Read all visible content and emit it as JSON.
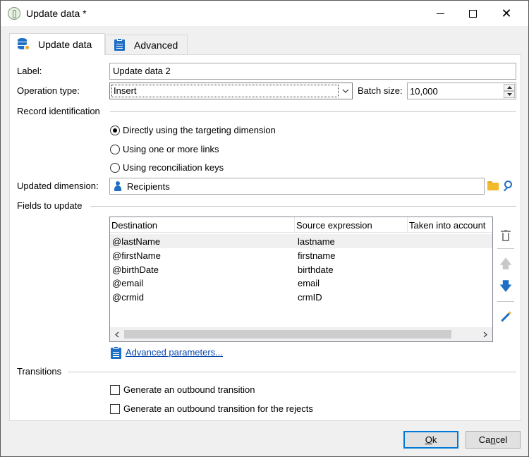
{
  "window": {
    "title": "Update data *",
    "minimize_glyph": "",
    "close_glyph": "✕"
  },
  "tabs": [
    {
      "label": "Update data",
      "active": true
    },
    {
      "label": "Advanced",
      "active": false
    }
  ],
  "form": {
    "label_caption": "Label:",
    "label_value": "Update data 2",
    "operation_caption": "Operation type:",
    "operation_value": "Insert",
    "batch_caption": "Batch size:",
    "batch_value": "10,000"
  },
  "record_identification": {
    "title": "Record identification",
    "options": [
      {
        "label": "Directly using the targeting dimension",
        "selected": true
      },
      {
        "label": "Using one or more links",
        "selected": false
      },
      {
        "label": "Using reconciliation keys",
        "selected": false
      }
    ]
  },
  "dimension": {
    "caption": "Updated dimension:",
    "value": "Recipients"
  },
  "fields": {
    "title": "Fields to update",
    "columns": [
      "Destination",
      "Source expression",
      "Taken into account"
    ],
    "rows": [
      [
        "@lastName",
        "lastname",
        ""
      ],
      [
        "@firstName",
        "firstname",
        ""
      ],
      [
        "@birthDate",
        "birthdate",
        ""
      ],
      [
        "@email",
        "email",
        ""
      ],
      [
        "@crmid",
        "crmID",
        ""
      ]
    ],
    "selected_row": 0,
    "advanced_link": "Advanced parameters..."
  },
  "transitions": {
    "title": "Transitions",
    "options": [
      {
        "label": "Generate an outbound transition",
        "checked": false
      },
      {
        "label": "Generate an outbound transition for the rejects",
        "checked": false
      }
    ]
  },
  "buttons": {
    "ok_mnemonic": "O",
    "ok_rest": "k",
    "cancel_prefix": "Ca",
    "cancel_mnemonic": "n",
    "cancel_rest": "cel"
  },
  "colors": {
    "accent": "#1f6fc5",
    "link": "#0645ad",
    "folder": "#f2b92a",
    "focus_border": "#0078d7"
  }
}
